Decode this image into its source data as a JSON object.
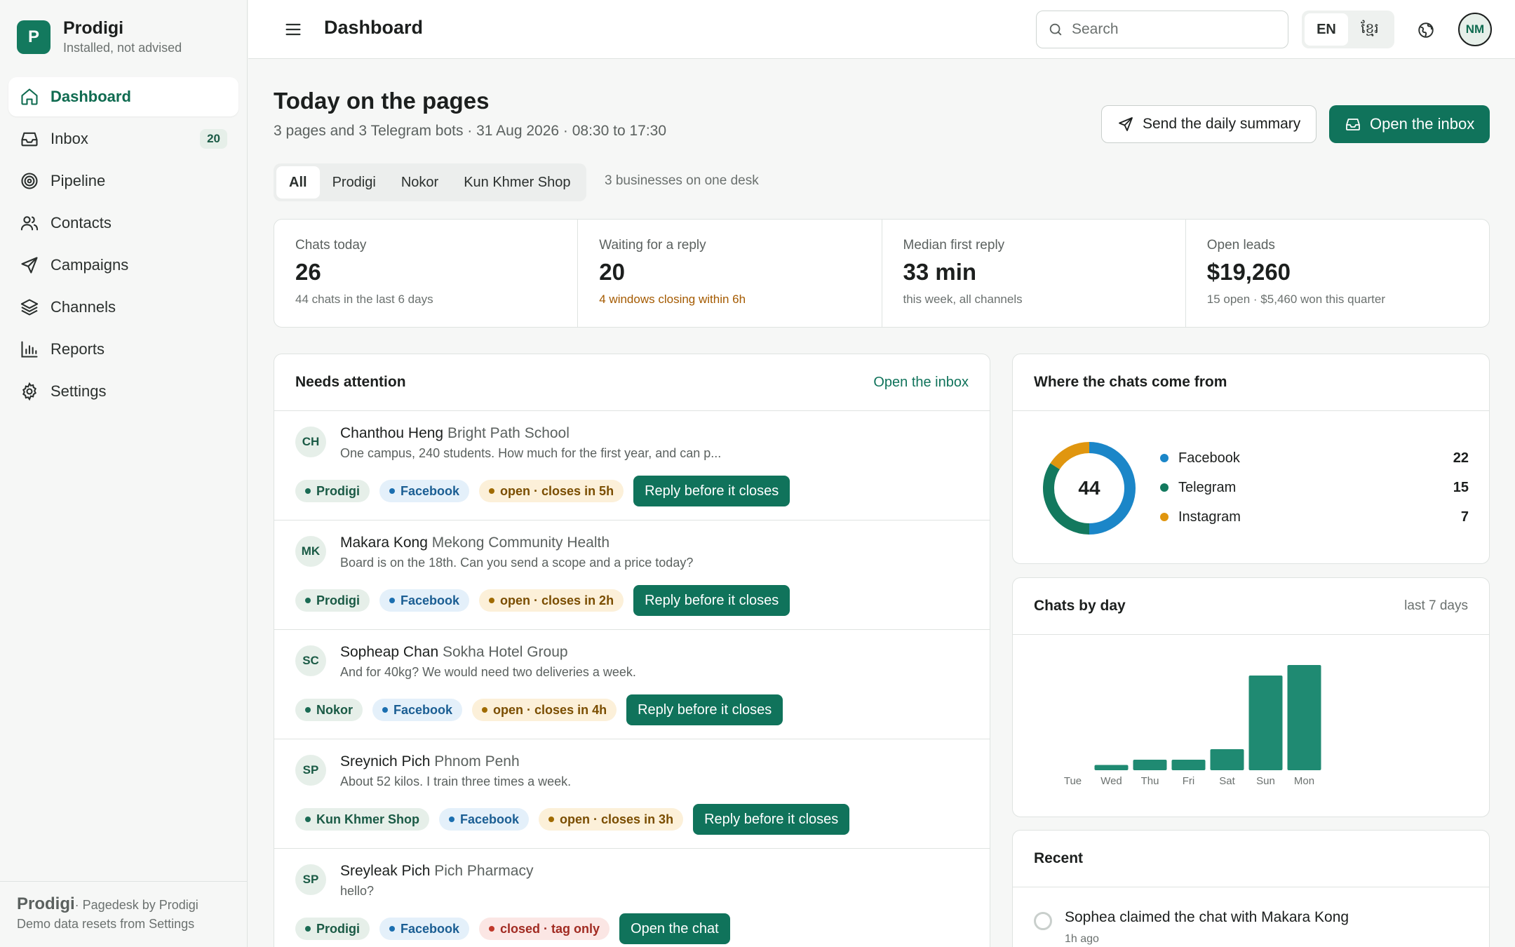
{
  "app": {
    "logo_letter": "P",
    "name": "Prodigi",
    "subtitle": "Installed, not advised"
  },
  "sidebar": {
    "items": [
      {
        "label": "Dashboard",
        "icon": "home-icon",
        "active": true
      },
      {
        "label": "Inbox",
        "icon": "inbox-icon",
        "badge": "20"
      },
      {
        "label": "Pipeline",
        "icon": "target-icon"
      },
      {
        "label": "Contacts",
        "icon": "users-icon"
      },
      {
        "label": "Campaigns",
        "icon": "send-icon"
      },
      {
        "label": "Channels",
        "icon": "layers-icon"
      },
      {
        "label": "Reports",
        "icon": "bar-chart-icon"
      },
      {
        "label": "Settings",
        "icon": "gear-icon"
      }
    ],
    "footer": {
      "brand": "Prodigi",
      "tagline": "· Pagedesk by Prodigi",
      "note": "Demo data resets from Settings"
    }
  },
  "topbar": {
    "title": "Dashboard",
    "search_placeholder": "Search",
    "lang_en": "EN",
    "lang_km": "ខ្មែរ",
    "avatar": "NM"
  },
  "page": {
    "title": "Today on the pages",
    "subtitle": "3 pages and 3 Telegram bots · 31 Aug 2026 · 08:30 to 17:30",
    "send_summary": "Send the daily summary",
    "open_inbox": "Open the inbox",
    "filters": [
      "All",
      "Prodigi",
      "Nokor",
      "Kun Khmer Shop"
    ],
    "filters_note": "3 businesses on one desk"
  },
  "stats": [
    {
      "label": "Chats today",
      "value": "26",
      "note": "44 chats in the last 6 days"
    },
    {
      "label": "Waiting for a reply",
      "value": "20",
      "note": "4 windows closing within 6h"
    },
    {
      "label": "Median first reply",
      "value": "33 min",
      "note": "this week, all channels"
    },
    {
      "label": "Open leads",
      "value": "$19,260",
      "note": "15 open · $5,460 won this quarter"
    }
  ],
  "attention": {
    "title": "Needs attention",
    "link": "Open the inbox",
    "rows": [
      {
        "initials": "CH",
        "name": "Chanthou Heng",
        "org": "Bright Path School",
        "message": "One campus, 240 students. How much for the first year, and can p...",
        "business": "Prodigi",
        "channel": "Facebook",
        "status": "open · closes in 5h",
        "action": "Reply before it closes"
      },
      {
        "initials": "MK",
        "name": "Makara Kong",
        "org": "Mekong Community Health",
        "message": "Board is on the 18th. Can you send a scope and a price today?",
        "business": "Prodigi",
        "channel": "Facebook",
        "status": "open · closes in 2h",
        "action": "Reply before it closes"
      },
      {
        "initials": "SC",
        "name": "Sopheap Chan",
        "org": "Sokha Hotel Group",
        "message": "And for 40kg? We would need two deliveries a week.",
        "business": "Nokor",
        "channel": "Facebook",
        "status": "open · closes in 4h",
        "action": "Reply before it closes"
      },
      {
        "initials": "SP",
        "name": "Sreynich Pich",
        "org": "Phnom Penh",
        "message": "About 52 kilos. I train three times a week.",
        "business": "Kun Khmer Shop",
        "channel": "Facebook",
        "status": "open · closes in 3h",
        "action": "Reply before it closes"
      },
      {
        "initials": "SP",
        "name": "Sreyleak Pich",
        "org": "Pich Pharmacy",
        "message": "hello?",
        "business": "Prodigi",
        "channel": "Facebook",
        "status": "closed · tag only",
        "action": "Open the chat"
      }
    ]
  },
  "sources": {
    "title": "Where the chats come from",
    "total": "44",
    "items": [
      {
        "name": "Facebook",
        "value": 22,
        "color": "#1b86c8"
      },
      {
        "name": "Telegram",
        "value": 15,
        "color": "#13795e"
      },
      {
        "name": "Instagram",
        "value": 7,
        "color": "#e0960f"
      }
    ]
  },
  "byday": {
    "title": "Chats by day",
    "aside": "last 7 days"
  },
  "chart_data": {
    "type": "bar",
    "title": "Chats by day",
    "categories": [
      "Tue",
      "Wed",
      "Thu",
      "Fri",
      "Sat",
      "Sun",
      "Mon"
    ],
    "values": [
      0,
      1,
      2,
      2,
      4,
      18,
      20
    ],
    "color": "#1f8a72"
  },
  "recent": {
    "title": "Recent",
    "items": [
      {
        "text": "Sophea claimed the chat with Makara Kong",
        "time": "1h ago"
      }
    ]
  }
}
